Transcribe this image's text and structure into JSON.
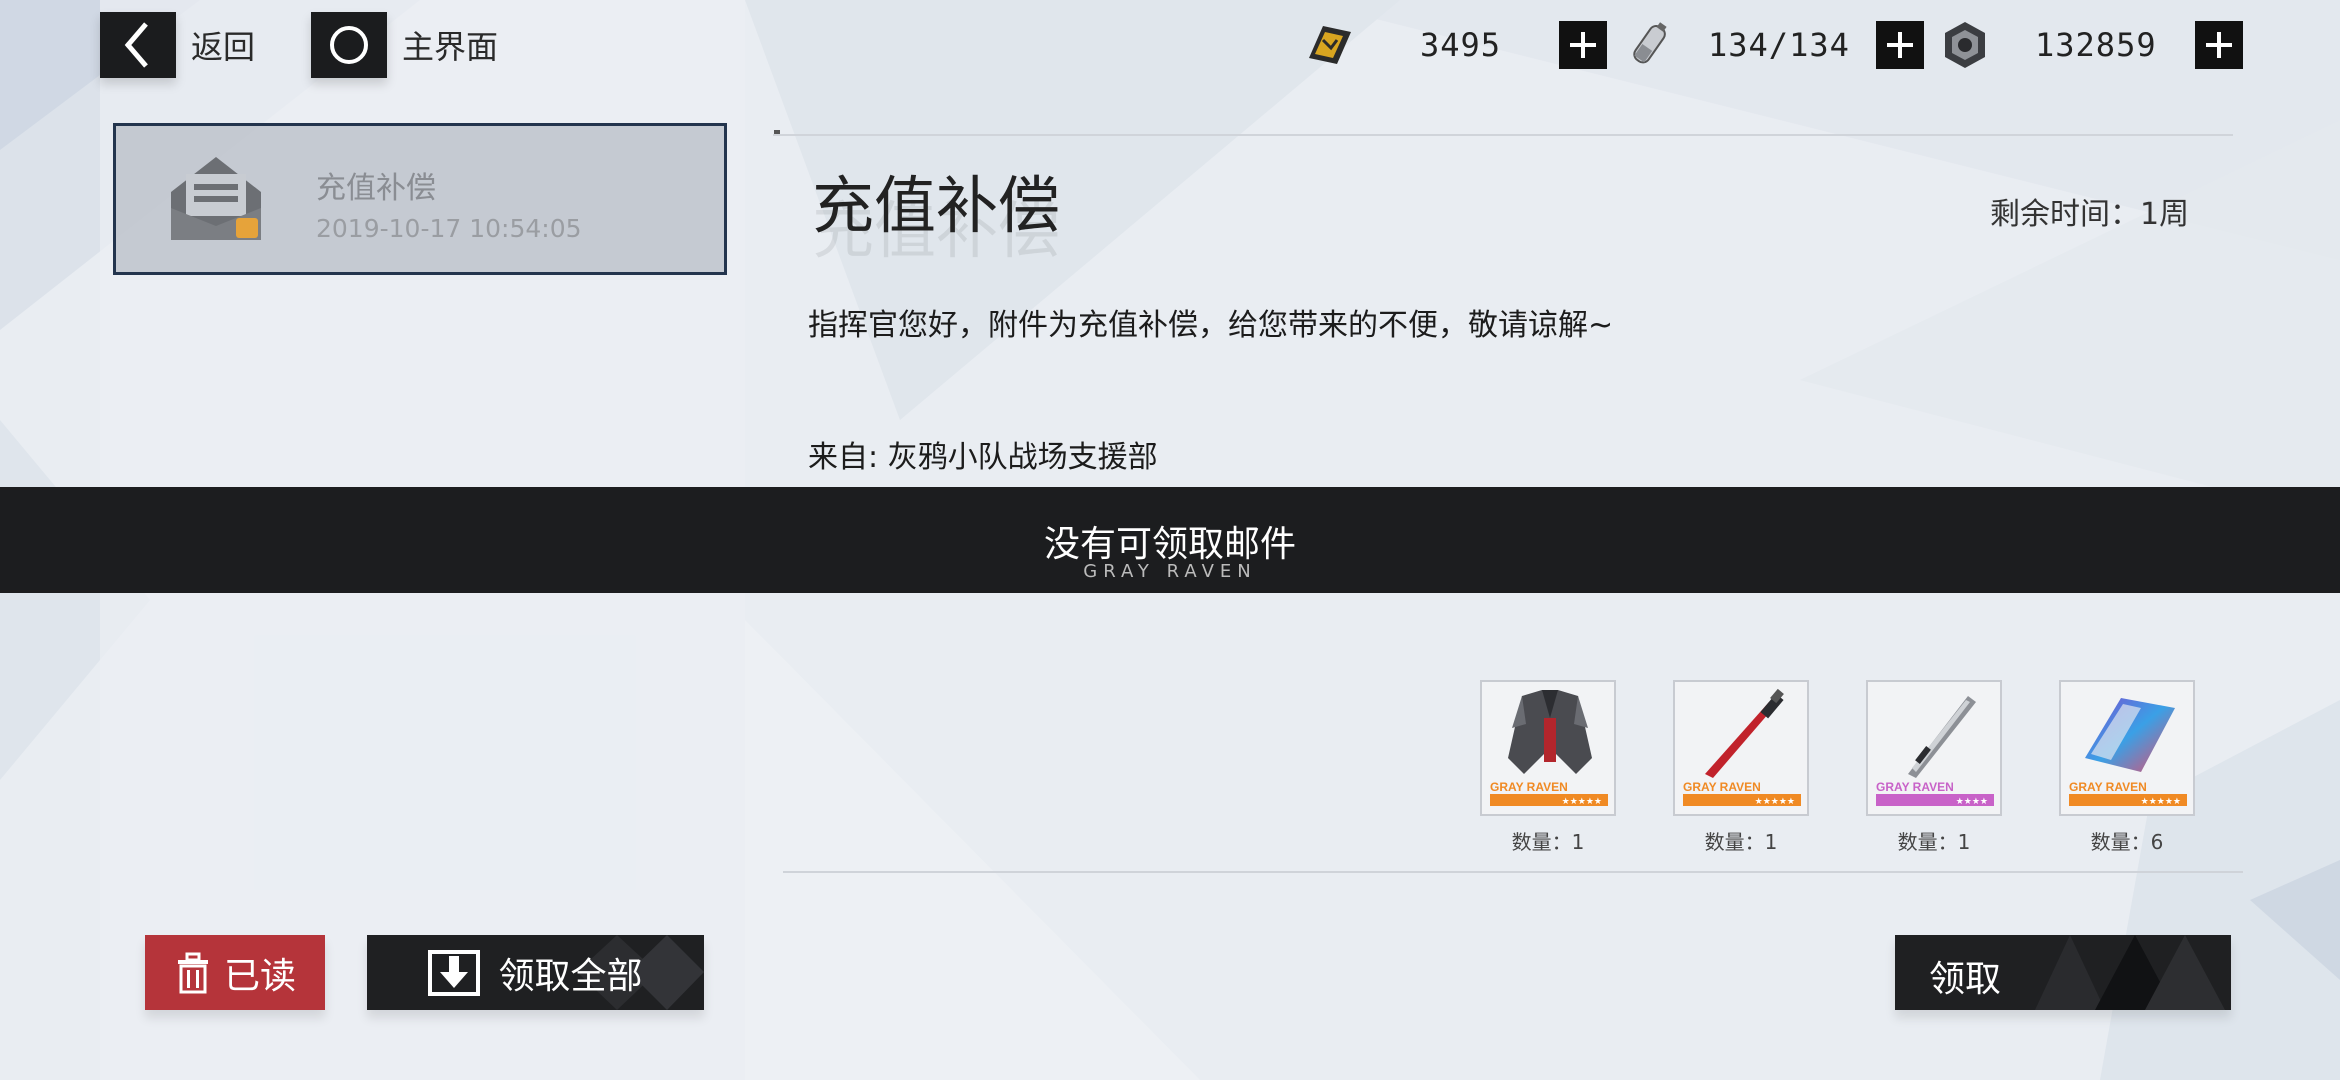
{
  "nav": {
    "back_label": "返回",
    "home_label": "主界面"
  },
  "resources": [
    {
      "icon": "gold-card-icon",
      "value": "3495"
    },
    {
      "icon": "battery-icon",
      "value": "134/134"
    },
    {
      "icon": "hex-nut-icon",
      "value": "132859"
    }
  ],
  "mail_list": [
    {
      "title": "充值补偿",
      "time": "2019-10-17 10:54:05"
    }
  ],
  "mail": {
    "title": "充值补偿",
    "remaining": "剩余时间：1周",
    "body": "指挥官您好，附件为充值补偿，给您带来的不便，敬请谅解~",
    "from": "来自: 灰鸦小队战场支援部"
  },
  "banner": {
    "title": "没有可领取邮件",
    "subtitle": "GRAY RAVEN"
  },
  "attachments": [
    {
      "name": "coat-item-icon",
      "count_label": "数量：1",
      "brand": "GRAY RAVEN",
      "rarity_color": "#f08a24"
    },
    {
      "name": "red-blade-item-icon",
      "count_label": "数量：1",
      "brand": "GRAY RAVEN",
      "rarity_color": "#f08a24"
    },
    {
      "name": "sword-item-icon",
      "count_label": "数量：1",
      "brand": "GRAY RAVEN",
      "rarity_color": "#c862c8"
    },
    {
      "name": "data-card-item-icon",
      "count_label": "数量：6",
      "brand": "GRAY RAVEN",
      "rarity_color": "#f08a24"
    }
  ],
  "buttons": {
    "read": "已读",
    "claim_all": "领取全部",
    "claim": "领取"
  },
  "colors": {
    "accent_red": "#b5343a",
    "dark": "#1c1d1f",
    "rarity_orange": "#f08a24",
    "rarity_purple": "#c862c8"
  }
}
